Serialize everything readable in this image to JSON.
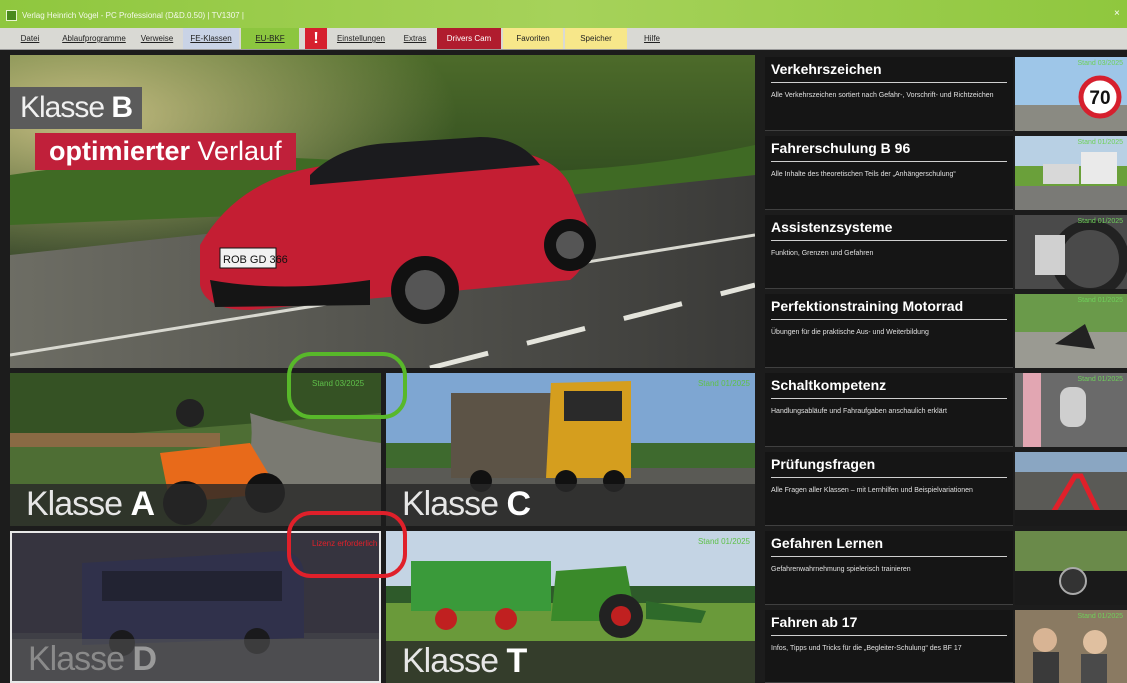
{
  "window": {
    "title": "Verlag Heinrich Vogel - PC Professional (D&D.0.50) | TV1307 |",
    "close_glyph": "×"
  },
  "menu": {
    "datei": "Datei",
    "ablaufprogramme": "Ablaufprogramme",
    "verweise": "Verweise",
    "fe_klassen": "FE-Klassen",
    "eu_bkf": "EU-BKF",
    "alert": "!",
    "einstellungen": "Einstellungen",
    "extras": "Extras",
    "drivers_cam": "Drivers Cam",
    "favoriten": "Favoriten",
    "speicher": "Speicher",
    "hilfe": "Hilfe"
  },
  "hero": {
    "klasse_prefix": "Klasse",
    "klasse_letter": "B",
    "badge_bold": "optimierter",
    "badge_rest": " Verlauf",
    "plate": "ROB GD 366"
  },
  "tiles": {
    "a": {
      "prefix": "Klasse",
      "letter": "A",
      "stand": "Stand 03/2025"
    },
    "c": {
      "prefix": "Klasse",
      "letter": "C",
      "stand": "Stand 01/2025"
    },
    "d": {
      "prefix": "Klasse",
      "letter": "D",
      "stand": "Lizenz erforderlich"
    },
    "t": {
      "prefix": "Klasse",
      "letter": "T",
      "stand": "Stand 01/2025"
    }
  },
  "sidebar": {
    "items": [
      {
        "title": "Verkehrszeichen",
        "desc": "Alle Verkehrszeichen sortiert nach Gefahr-, Vorschrift- und Richtzeichen",
        "thumb_stand": "Stand 03/2025",
        "sign": "70"
      },
      {
        "title": "Fahrerschulung B 96",
        "desc": "Alle Inhalte des theoretischen Teils der „Anhängerschulung“",
        "thumb_stand": "Stand 01/2025"
      },
      {
        "title": "Assistenzsysteme",
        "desc": "Funktion, Grenzen und Gefahren",
        "thumb_stand": "Stand 01/2025"
      },
      {
        "title": "Perfektionstraining Motorrad",
        "desc": "Übungen für die praktische Aus- und Weiterbildung",
        "thumb_stand": "Stand 01/2025"
      },
      {
        "title": "Schaltkompetenz",
        "desc": "Handlungsabläufe und Fahraufgaben anschaulich erklärt",
        "thumb_stand": "Stand 01/2025"
      },
      {
        "title": "Prüfungsfragen",
        "desc": "Alle Fragen aller Klassen – mit Lernhilfen und Beispielvariationen",
        "thumb_stand": ""
      },
      {
        "title": "Gefahren Lernen",
        "desc": "Gefahrenwahrnehmung spielerisch trainieren",
        "thumb_stand": ""
      },
      {
        "title": "Fahren ab 17",
        "desc": "Infos, Tipps und Tricks für die „Begleiter-Schulung“ des BF 17",
        "thumb_stand": "Stand 01/2025"
      }
    ]
  },
  "colors": {
    "titlebar_green": "#8fc73e",
    "menu_bg": "#d9d9d4",
    "eu_bkf_bg": "#8cc63f",
    "alert_bg": "#d6202e",
    "drivers_cam_bg": "#b01c2e",
    "favoriten_bg": "#f7e78a",
    "speicher_bg": "#f7e78a",
    "fe_klassen_bg": "#c9d3e6",
    "stand_green": "#5fc04a",
    "annotation_green": "#58b82a",
    "annotation_red": "#e0202a"
  }
}
